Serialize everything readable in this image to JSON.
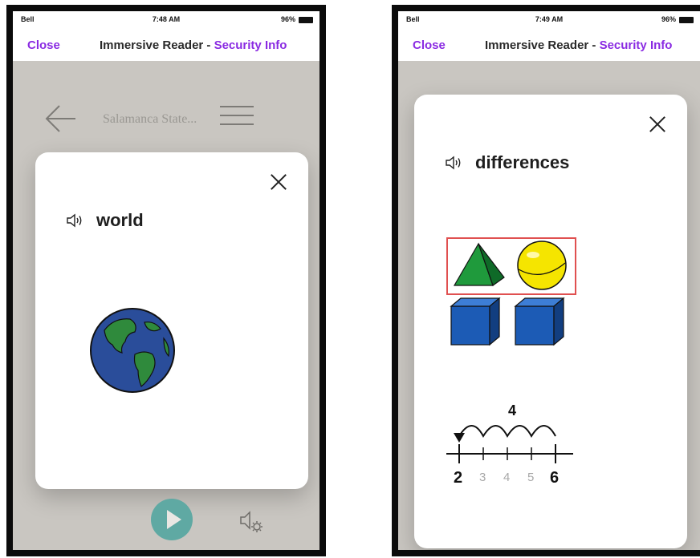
{
  "colors": {
    "accent": "#8a2be2",
    "backdrop": "#c9c6c1",
    "play": "#5fa9a3",
    "highlight": "#e05050"
  },
  "left_phone": {
    "status_bar": {
      "carrier": "Bell",
      "time": "7:48 AM",
      "battery": "96%"
    },
    "nav": {
      "close_label": "Close",
      "title": "Immersive Reader - ",
      "security_link": "Security Info"
    },
    "background_page": {
      "site_title": "Salamanca State..."
    },
    "card": {
      "word": "world",
      "picture": "globe-icon"
    },
    "bottom_controls": {
      "play": "play-icon",
      "voice_settings": "voice-settings-icon"
    }
  },
  "right_phone": {
    "status_bar": {
      "carrier": "Bell",
      "time": "7:49 AM",
      "battery": "96%"
    },
    "nav": {
      "close_label": "Close",
      "title": "Immersive Reader - ",
      "security_link": "Security Info"
    },
    "card": {
      "word": "differences",
      "picture": "shapes-and-number-line",
      "jump_label": "4",
      "number_line": [
        "2",
        "3",
        "4",
        "5",
        "6"
      ]
    }
  }
}
